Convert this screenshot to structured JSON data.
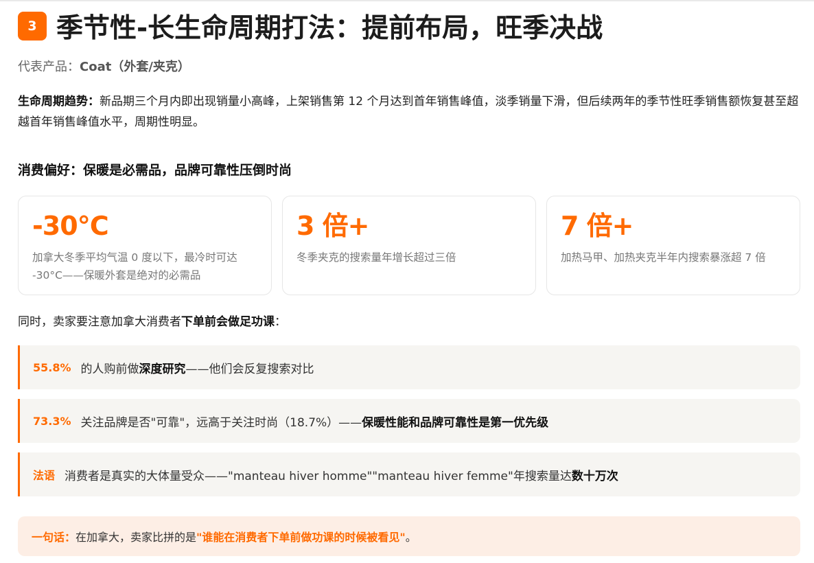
{
  "header": {
    "number": "3",
    "title": "季节性-长生命周期打法：提前布局，旺季决战"
  },
  "product": {
    "label": "代表产品：",
    "value": "Coat（外套/夹克）"
  },
  "trend": {
    "label": "生命周期趋势：",
    "text": "新品期三个月内即出现销量小高峰，上架销售第 12 个月达到首年销售峰值，淡季销量下滑，但后续两年的季节性旺季销售额恢复甚至超越首年销售峰值水平，周期性明显。"
  },
  "preference": {
    "heading": "消费偏好：保暖是必需品，品牌可靠性压倒时尚"
  },
  "cards": [
    {
      "big": "-30℃",
      "desc": "加拿大冬季平均气温 0 度以下，最冷时可达 -30°C——保暖外套是绝对的必需品"
    },
    {
      "big": "3 倍+",
      "desc": "冬季夹克的搜索量年增长超过三倍"
    },
    {
      "big": "7 倍+",
      "desc": "加热马甲、加热夹克半年内搜索暴涨超 7 倍"
    }
  ],
  "intro": {
    "text": "同时，卖家要注意加拿大消费者",
    "bold": "下单前会做足功课",
    "end": "："
  },
  "points": [
    {
      "key": "55.8%",
      "text": "的人购前做",
      "bold": "深度研究",
      "tail": "——他们会反复搜索对比"
    },
    {
      "key": "73.3%",
      "text": "关注品牌是否\"可靠\"，远高于关注时尚（18.7%）——",
      "bold": "保暖性能和品牌可靠性是第一优先级",
      "tail": ""
    },
    {
      "key": "法语",
      "text": "消费者是真实的大体量受众——\"manteau hiver homme\"\"manteau hiver femme\"年搜索量达",
      "bold": "数十万次",
      "tail": ""
    }
  ],
  "summary": {
    "label": "一句话：",
    "text": "在加拿大，卖家比拼的是",
    "highlight": "\"谁能在消费者下单前做功课的时候被看见\"",
    "end": "。"
  },
  "colors": {
    "accent": "#ff6a00",
    "point_bg": "#f6f5f2",
    "summary_bg": "#fdeee5"
  }
}
